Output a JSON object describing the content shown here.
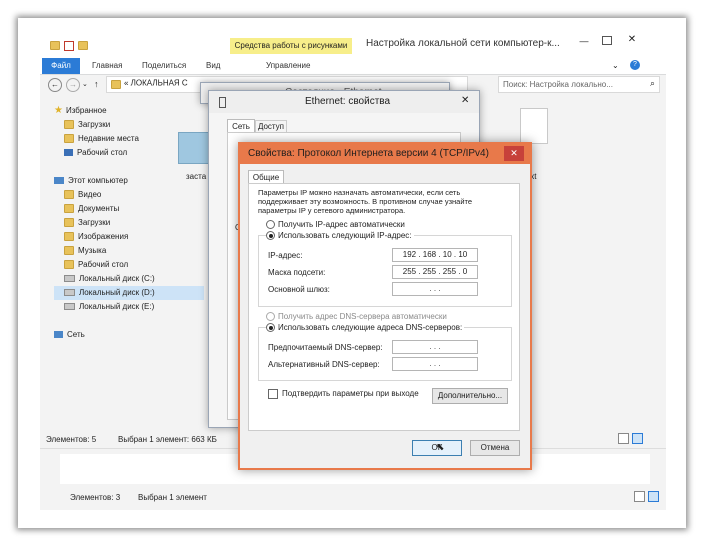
{
  "explorer": {
    "window_title": "Настройка локальной сети компьютер-к...",
    "contextual_tab": "Средства работы с рисунками",
    "tabs": [
      "Файл",
      "Главная",
      "Поделиться",
      "Вид",
      "Управление"
    ],
    "address": "« ЛОКАЛЬНАЯ С",
    "search_placeholder": "Поиск: Настройка локально...",
    "nav": {
      "favorites": "Избранное",
      "downloads": "Загрузки",
      "recent": "Недавние места",
      "desktop": "Рабочий стол",
      "this_pc": "Этот компьютер",
      "video": "Видео",
      "documents": "Документы",
      "downloads2": "Загрузки",
      "images": "Изображения",
      "music": "Музыка",
      "desktop2": "Рабочий стол",
      "disk_c": "Локальный диск (C:)",
      "disk_d": "Локальный диск (D:)",
      "disk_e": "Локальный диск (E:)",
      "network": "Сеть"
    },
    "file_label_left": "заста",
    "file_label_right": "txt",
    "status_items": "Элементов: 5",
    "status_selected": "Выбран 1 элемент: 663 КБ",
    "status2_items": "Элементов: 3",
    "status2_selected": "Выбран 1 элемент"
  },
  "status_window": {
    "title": "Состояние - Ethernet"
  },
  "ethernet": {
    "title": "Ethernet: свойства",
    "tab_network": "Сеть",
    "tab_access": "Доступ",
    "side_letter": "С"
  },
  "ipv4": {
    "title": "Свойства: Протокол Интернета версии 4 (TCP/IPv4)",
    "tab_general": "Общие",
    "description": "Параметры IP можно назначать автоматически, если сеть поддерживает эту возможность. В противном случае узнайте параметры IP у сетевого администратора.",
    "auto_ip": "Получить IP-адрес автоматически",
    "manual_ip": "Использовать следующий IP-адрес:",
    "ip_label": "IP-адрес:",
    "ip_value": "192 . 168 . 10 . 10",
    "mask_label": "Маска подсети:",
    "mask_value": "255 . 255 . 255 . 0",
    "gateway_label": "Основной шлюз:",
    "empty_ip": ".      .      .",
    "auto_dns": "Получить адрес DNS-сервера автоматически",
    "manual_dns": "Использовать следующие адреса DNS-серверов:",
    "dns1_label": "Предпочитаемый DNS-сервер:",
    "dns2_label": "Альтернативный DNS-сервер:",
    "validate": "Подтвердить параметры при выходе",
    "advanced": "Дополнительно...",
    "ok": "ОК",
    "cancel": "Отмена"
  },
  "colors": {
    "accent_blue": "#2b7bd6",
    "dialog_orange": "#e8794a",
    "contextual_yellow": "#f7ee8a"
  }
}
